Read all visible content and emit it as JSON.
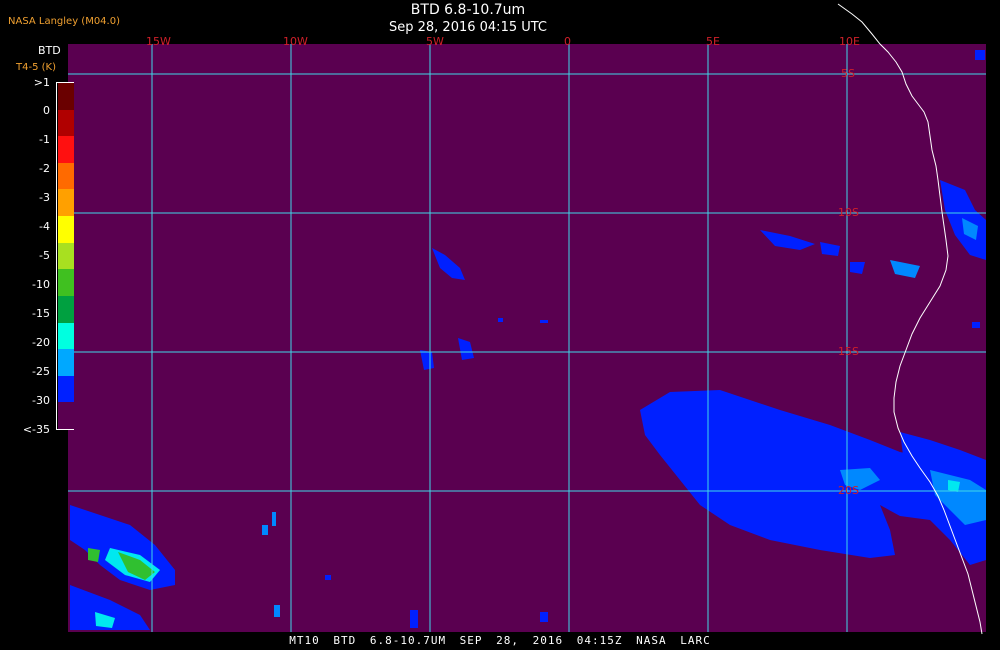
{
  "header": {
    "title": "BTD 6.8-10.7um",
    "timestamp": "Sep 28, 2016 04:15 UTC",
    "producer": "NASA Langley (M04.0)"
  },
  "legend": {
    "title": "BTD",
    "subtitle": "T4-5 (K)",
    "labels": [
      ">1",
      "0",
      "-1",
      "-2",
      "-3",
      "-4",
      "-5",
      "-10",
      "-15",
      "-20",
      "-25",
      "-30",
      "<-35"
    ],
    "colors": [
      "#6a0000",
      "#b00000",
      "#ff1010",
      "#ff6a00",
      "#ffa000",
      "#ffff00",
      "#a8e020",
      "#40c020",
      "#00a040",
      "#00ffe0",
      "#00a8ff",
      "#0020ff",
      "#5a0050"
    ]
  },
  "map": {
    "lon_labels": [
      "15W",
      "10W",
      "5W",
      "0",
      "5E",
      "10E"
    ],
    "lat_labels": [
      "5S",
      "10S",
      "15S",
      "20S"
    ],
    "colors": {
      "background": "#5a0050",
      "grid": "#40d8e8",
      "grid_label": "#d0202a",
      "coast": "#ffffff",
      "cloud_blue": "#0020ff",
      "cloud_light": "#0088ff",
      "cloud_cyan": "#00e8f0",
      "cloud_green": "#30c030"
    }
  },
  "footer": {
    "text": "MT10  BTD 6.8-10.7UM  SEP 28, 2016 04:15Z  NASA LARC"
  }
}
